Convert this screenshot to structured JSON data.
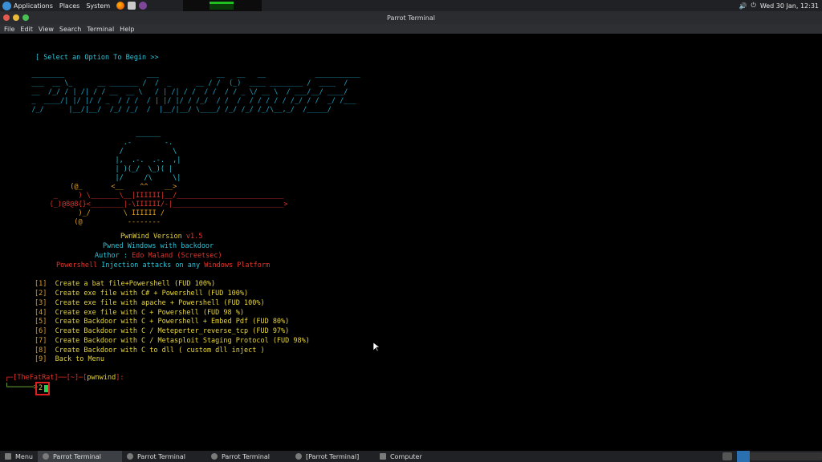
{
  "top_panel": {
    "applications": "Applications",
    "places": "Places",
    "system": "System",
    "clock": "Wed 30 Jan, 12:31"
  },
  "window": {
    "title": "Parrot Terminal",
    "menu": [
      "File",
      "Edit",
      "View",
      "Search",
      "Terminal",
      "Help"
    ]
  },
  "terminal": {
    "select_prompt": "[ Select an Option To Begin >>",
    "ascii_logo": [
      "   ________                    ___              __   __   __            ___________",
      "   ___  __ \\_      __ _______ /  /  _      __ / /  (_)  ____ ________ /  ____  /",
      "   __  /_/ / | /| / / __  __ \\   / | /| / /  / /  / / _ \\/ __ \\  / ___/__/ ____/",
      "   _  ____/| |/ |/ / _  / / /  / | |/ |/ / /_/  / /  /  / / / / / /_/ / /  _/ /___",
      "   /_/      |__/|__/  /_/ /_/  /  |__/|__/ \\____/ /_/ /_/ /_/\\__,_/  /_____/"
    ],
    "hacker_art": [
      "                                   ______",
      "                                .-        -.",
      "                               /            \\",
      "                              |,  .-.  .-.  ,|",
      "                              | )(_/  \\_)( |",
      "                              |/     /\\     \\|",
      "                   (@_       <__    ^^    __>",
      "               _     ) \\_______\\__|IIIIII|__/__________________________",
      "              (_)@8@8{}<________|-\\IIIIII/-|___________________________>",
      "                     )_/        \\ IIIIII /",
      "                    (@           --------"
    ],
    "version_label": "PwnWind Version ",
    "version": "v1.5",
    "tagline": "Pwned Windows with backdoor",
    "author_label": "Author : ",
    "author": "Edo Maland (Screetsec)",
    "inj_prefix": "Powershell",
    "inj_middle": " Injection attacks on any ",
    "inj_suffix": "Windows Platform",
    "options": [
      {
        "num": "[1]",
        "text": "  Create a bat file+Powershell (FUD 100%)"
      },
      {
        "num": "[2]",
        "text": "  Create exe file with C# + Powershell (FUD 100%)"
      },
      {
        "num": "[3]",
        "text": "  Create exe file with apache + Powershell (FUD 100%)"
      },
      {
        "num": "[4]",
        "text": "  Create exe file with C + Powershell (FUD 98 %)"
      },
      {
        "num": "[5]",
        "text": "  Create Backdoor with C + Powershell + Embed Pdf (FUD 80%)"
      },
      {
        "num": "[6]",
        "text": "  Create Backdoor with C / Meteperter_reverse_tcp (FUD 97%)"
      },
      {
        "num": "[7]",
        "text": "  Create Backdoor with C / Metasploit Staging Protocol (FUD 98%)"
      },
      {
        "num": "[8]",
        "text": "  Create Backdoor with C to dll ( custom dll inject )"
      },
      {
        "num": "[9]",
        "text": "  Back to Menu"
      }
    ],
    "prompt_open": "┌─[",
    "prompt_user": "TheFatRat",
    "prompt_mid": "]──[~]─[",
    "prompt_module": "pwnwind",
    "prompt_close": "]:",
    "prompt_arrow": "└──────>",
    "input_value": "2"
  },
  "taskbar": {
    "menu": "Menu",
    "tasks": [
      "Parrot Terminal",
      "Parrot Terminal",
      "Parrot Terminal",
      "[Parrot Terminal]",
      "Computer"
    ]
  }
}
